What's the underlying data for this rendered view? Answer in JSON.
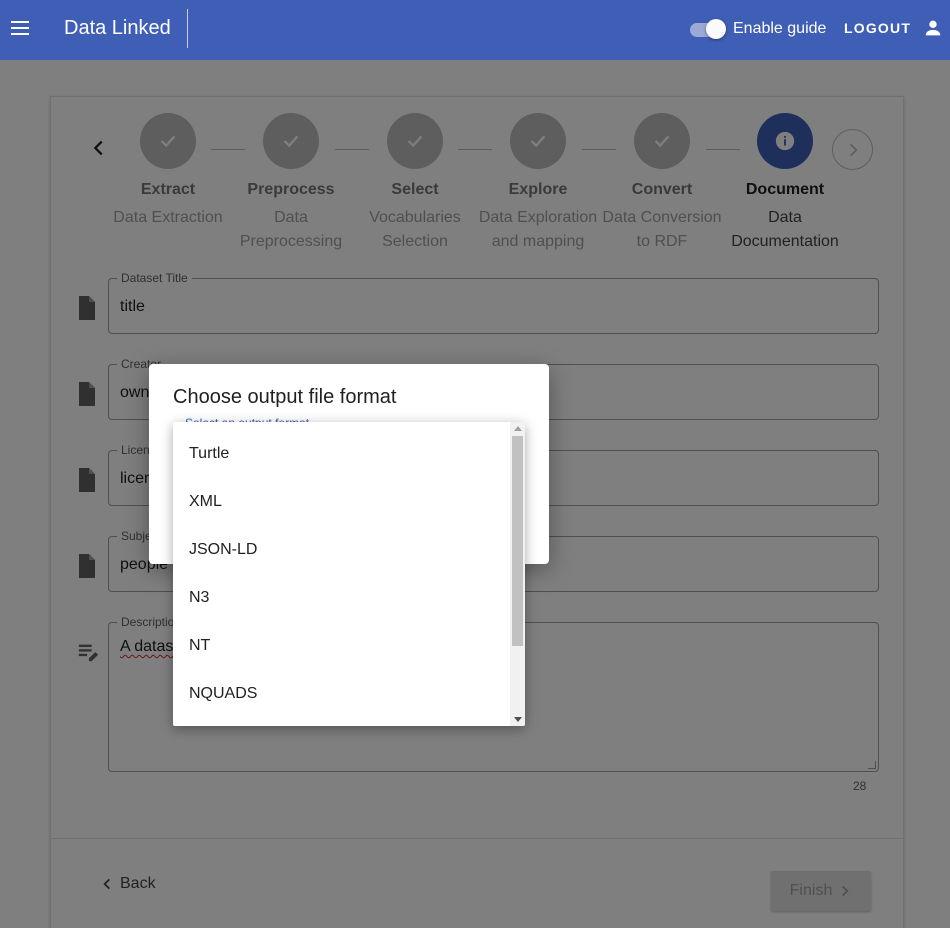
{
  "appbar": {
    "title": "Data Linked",
    "guide_toggle_label": "Enable guide",
    "guide_enabled": true,
    "logout_label": "LOGOUT"
  },
  "stepper": {
    "steps": [
      {
        "label": "Extract",
        "sub": "Data Extraction",
        "state": "completed"
      },
      {
        "label": "Preprocess",
        "sub": "Data Preprocessing",
        "state": "completed"
      },
      {
        "label": "Select",
        "sub": "Vocabularies Selection",
        "state": "completed"
      },
      {
        "label": "Explore",
        "sub": "Data Exploration and mapping",
        "state": "completed"
      },
      {
        "label": "Convert",
        "sub": "Data Conversion to RDF",
        "state": "completed"
      },
      {
        "label": "Document",
        "sub": "Data Documentation",
        "state": "active"
      }
    ]
  },
  "form": {
    "dataset_title": {
      "label": "Dataset Title",
      "value": "title"
    },
    "creator": {
      "label": "Creator",
      "value": "own"
    },
    "license": {
      "label": "Licen",
      "value": "licen"
    },
    "subject": {
      "label": "Subje",
      "value": "people"
    },
    "description": {
      "label": "Description",
      "value": "A datas"
    },
    "char_count": "28"
  },
  "buttons": {
    "back_label": "Back",
    "finish_label": "Finish"
  },
  "dialog": {
    "title": "Choose output file format",
    "select_label": "Select an output format",
    "options": [
      "Turtle",
      "XML",
      "JSON-LD",
      "N3",
      "NT",
      "NQUADS"
    ]
  },
  "colors": {
    "primary": "#3f5eb6",
    "step_done": "#bdbdbd"
  }
}
